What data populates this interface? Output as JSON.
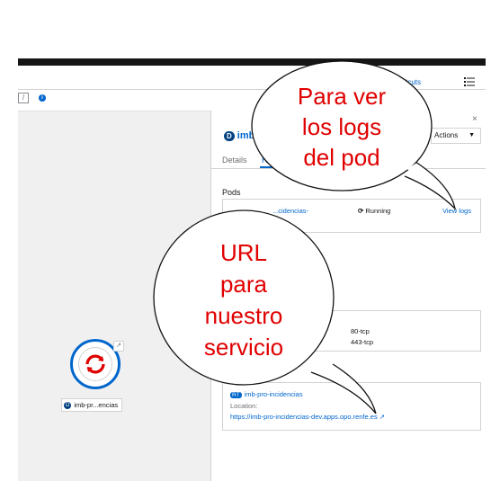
{
  "toolbar": {
    "shortcuts_label": "ortcuts",
    "breadcrumb_label": "/"
  },
  "topology": {
    "node_badge": "D",
    "node_label": "imb-pr...encias"
  },
  "side_panel": {
    "close_label": "×",
    "badge": "D",
    "title": "imb-",
    "actions_label": "Actions",
    "tabs": [
      "Details",
      "Reso"
    ],
    "pods_heading": "Pods",
    "pod_name": "...cidencias-",
    "pod_status": "Running",
    "view_logs_label": "View logs",
    "service_ports": [
      "80-tcp",
      "443-tcp"
    ],
    "route": {
      "badge": "RT",
      "name": "imb-pro-incidencias",
      "location_label": "Location:",
      "url": "https://imb-pro-incidencias-dev.apps.opo.renfe.es"
    }
  },
  "callouts": {
    "logs_lines": [
      "Para ver",
      "los logs",
      "del pod"
    ],
    "url_lines": [
      "URL",
      "para",
      "nuestro",
      "servicio"
    ]
  },
  "colors": {
    "link": "#0066cc",
    "callout_text": "#e00000",
    "masthead": "#151515"
  }
}
